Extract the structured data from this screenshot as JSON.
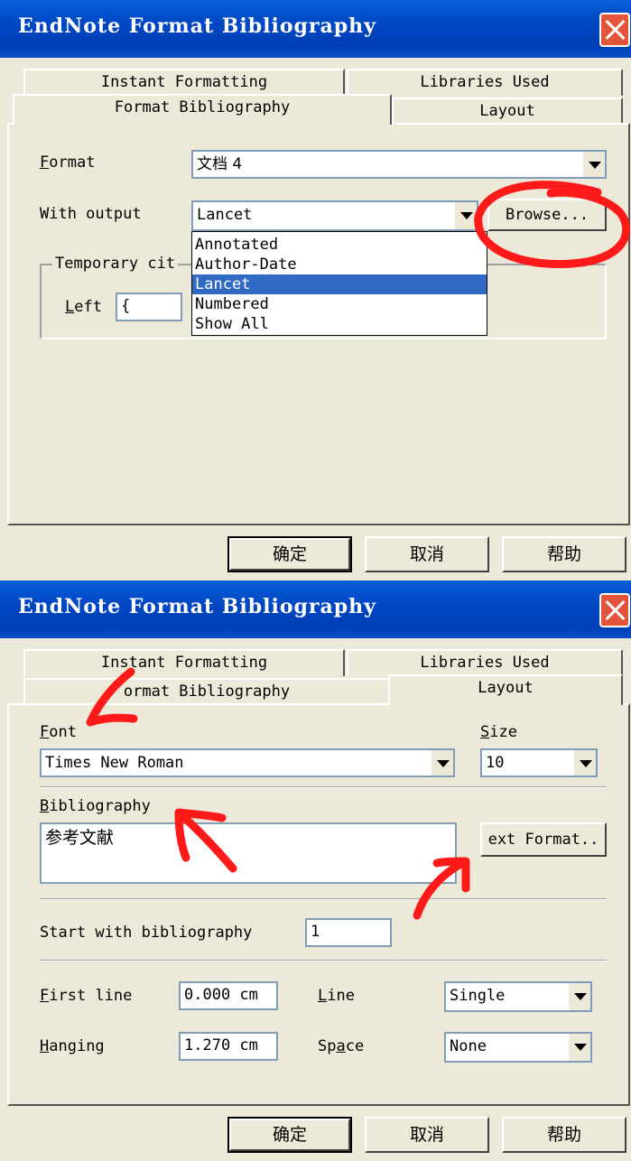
{
  "dialog_top": {
    "title": "EndNote Format Bibliography",
    "tabs": {
      "instant": "Instant Formatting",
      "libraries": "Libraries Used",
      "format": "Format Bibliography",
      "layout": "Layout"
    },
    "format_label": "Format",
    "format_value": "文档 4",
    "output_label": "With output",
    "output_value": "Lancet",
    "browse_label": "Browse...",
    "group_label": "Temporary cit",
    "left_label": "Left",
    "left_value": "{",
    "dropdown_options": [
      "Annotated",
      "Author-Date",
      "Lancet",
      "Numbered",
      "Show All"
    ],
    "ok": "确定",
    "cancel": "取消",
    "help": "帮助"
  },
  "dialog_bottom": {
    "title": "EndNote Format Bibliography",
    "tabs": {
      "instant": "Instant Formatting",
      "libraries": "Libraries Used",
      "format": "ormat Bibliography",
      "layout": "Layout"
    },
    "font_label": "Font",
    "font_value": "Times New Roman",
    "size_label": "Size",
    "size_value": "10",
    "bib_label": "Bibliography",
    "bib_text": "参考文献",
    "text_format_label": "ext Format..",
    "start_label": "Start with bibliography",
    "start_value": "1",
    "first_line_label": "First line",
    "first_line_value": "0.000 cm",
    "hanging_label": "Hanging",
    "hanging_value": "1.270 cm",
    "line_label": "Line",
    "line_value": "Single",
    "space_label": "Space",
    "space_value": "None",
    "ok": "确定",
    "cancel": "取消",
    "help": "帮助"
  },
  "colors": {
    "titlebar": "#0047c4",
    "dialog_bg": "#ece9d8",
    "selection": "#316ac5",
    "annotation": "#ff1a1a"
  }
}
